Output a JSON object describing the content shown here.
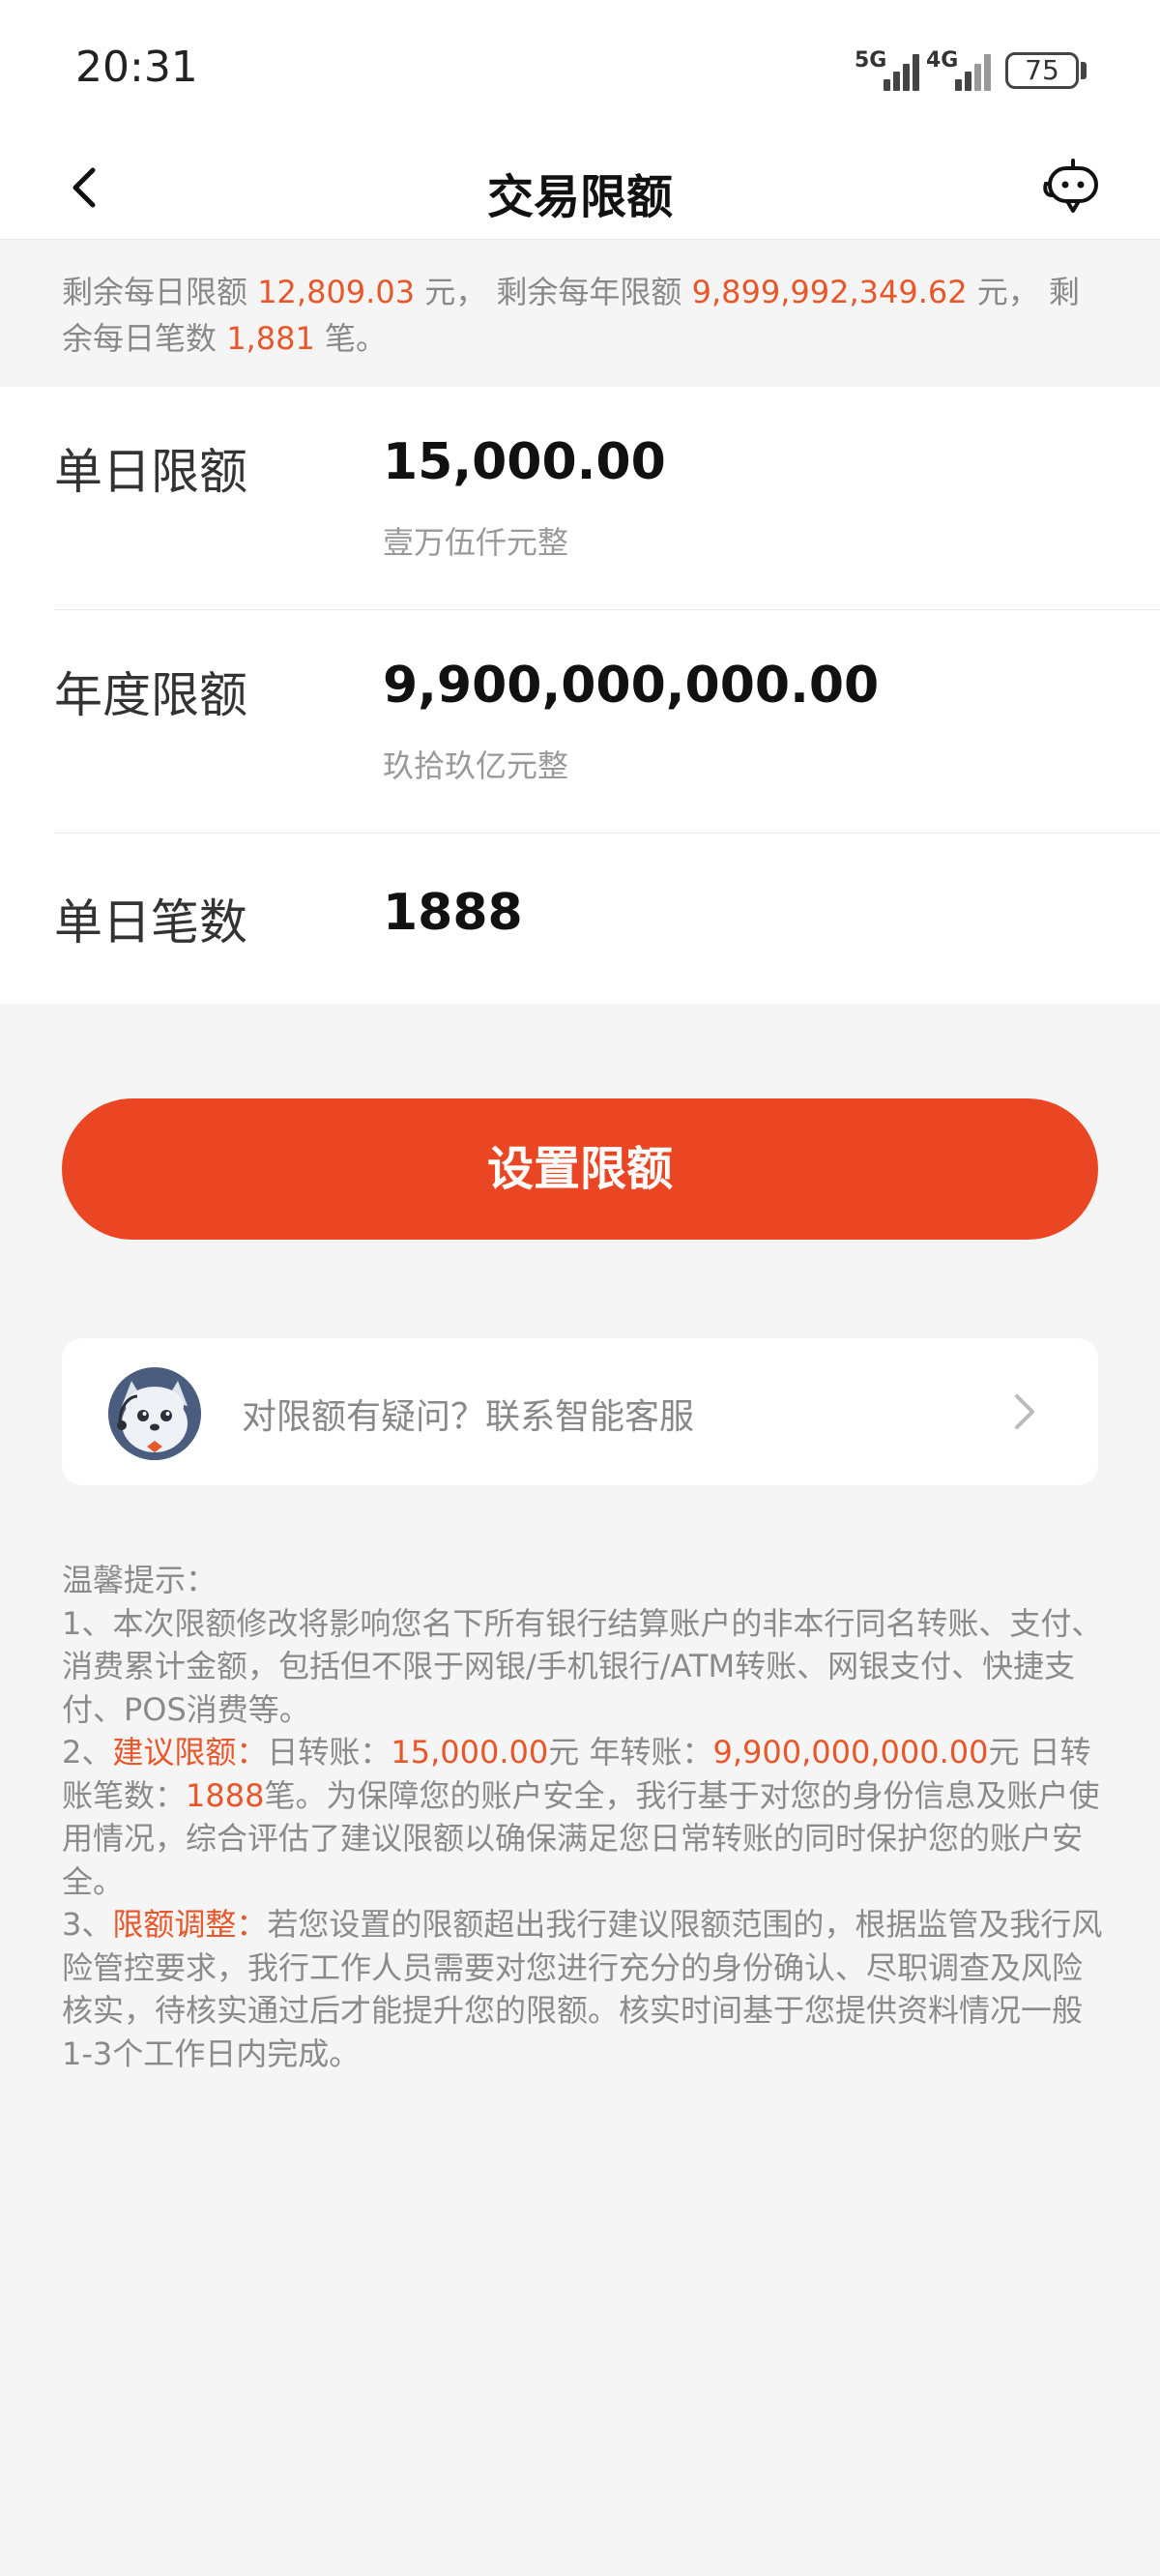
{
  "status_bar": {
    "time": "20:31",
    "signal_1_label": "5G",
    "signal_2_label": "4G",
    "battery": "75"
  },
  "nav": {
    "title": "交易限额",
    "back_icon": "chevron-left-icon",
    "assistant_icon": "robot-chat-icon"
  },
  "summary": {
    "daily_remaining_label": "剩余每日限额",
    "daily_remaining_value": "12,809.03",
    "yearly_remaining_label": "元， 剩余每年限额",
    "yearly_remaining_value": "9,899,992,349.62",
    "count_remaining_label": "元， 剩余每日笔数",
    "count_remaining_value": "1,881",
    "count_unit": "笔。"
  },
  "form": {
    "daily": {
      "label": "单日限额",
      "value": "15,000.00",
      "uppercase": "壹万伍仟元整"
    },
    "yearly": {
      "label": "年度限额",
      "value": "9,900,000,000.00",
      "uppercase": "玖拾玖亿元整"
    },
    "count": {
      "label": "单日笔数",
      "value": "1888"
    }
  },
  "actions": {
    "set_limit_label": "设置限额"
  },
  "help": {
    "text": "对限额有疑问？联系智能客服"
  },
  "tips": {
    "title": "温馨提示：",
    "item1": "1、本次限额修改将影响您名下所有银行结算账户的非本行同名转账、支付、消费累计金额，包括但不限于网银/手机银行/ATM转账、网银支付、快捷支付、POS消费等。",
    "item2_prefix": "2、",
    "item2_highlight": "建议限额：",
    "item2_a": "日转账：",
    "item2_daily": "15,000.00",
    "item2_b": "元 年转账：",
    "item2_yearly": "9,900,000,000.00",
    "item2_c": "元 日转账笔数：",
    "item2_count": "1888",
    "item2_d": "笔。为保障您的账户安全，我行基于对您的身份信息及账户使用情况，综合评估了建议限额以确保满足您日常转账的同时保护您的账户安全。",
    "item3_prefix": "3、",
    "item3_highlight": "限额调整：",
    "item3_text": "若您设置的限额超出我行建议限额范围的，根据监管及我行风险管控要求，我行工作人员需要对您进行充分的身份确认、尽职调查及风险核实，待核实通过后才能提升您的限额。核实时间基于您提供资料情况一般1-3个工作日内完成。"
  },
  "colors": {
    "accent": "#ea4623",
    "highlight_text": "#e8572a",
    "background": "#f5f5f5"
  }
}
